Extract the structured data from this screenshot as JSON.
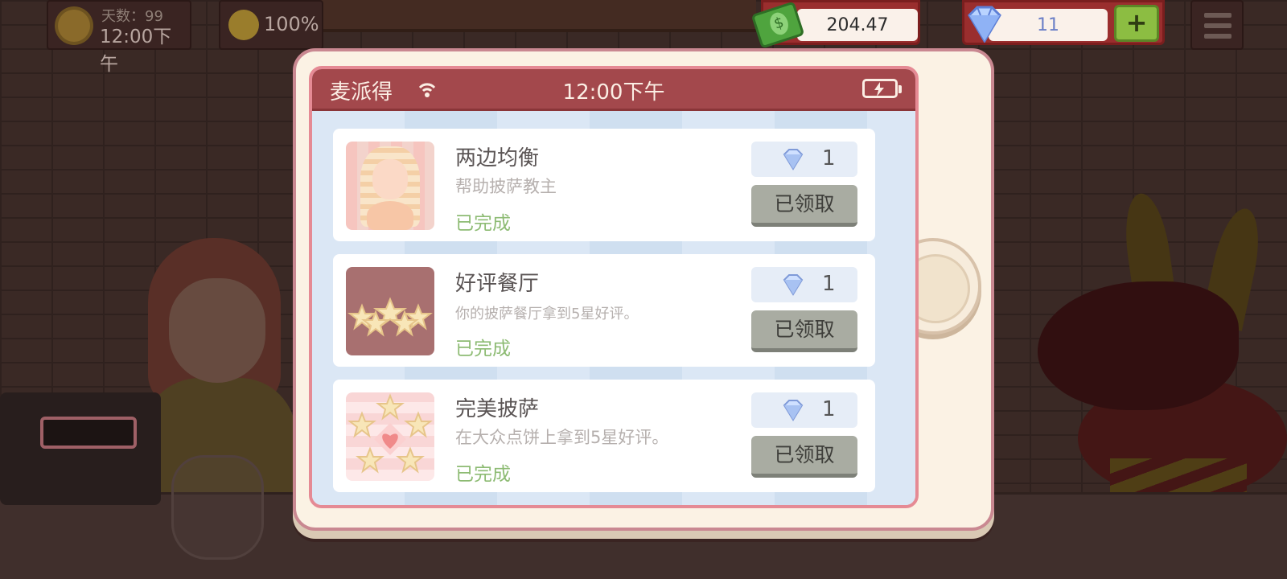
{
  "hud": {
    "day_label": "天数：99",
    "time": "12:00下午",
    "mood_percent": "100%",
    "cash": "204.47",
    "gems": "11",
    "add_label": "+"
  },
  "phone": {
    "app_name": "麦派得",
    "time": "12:00下午"
  },
  "achievements": [
    {
      "title": "两边均衡",
      "description": "帮助披萨教主",
      "status": "已完成",
      "reward": "1",
      "button": "已领取",
      "thumb_icon": "pharaoh-pizza-icon"
    },
    {
      "title": "好评餐厅",
      "description": "你的披萨餐厅拿到5星好评。",
      "status": "已完成",
      "reward": "1",
      "button": "已领取",
      "thumb_icon": "five-stars-icon"
    },
    {
      "title": "完美披萨",
      "description": "在大众点饼上拿到5星好评。",
      "status": "已完成",
      "reward": "1",
      "button": "已领取",
      "thumb_icon": "heart-stars-icon"
    }
  ],
  "colors": {
    "status_bar": "#a3484c",
    "completed_text": "#8dbb73",
    "claimed_button": "#a9aca2",
    "gem_text": "#6b7fc7"
  }
}
